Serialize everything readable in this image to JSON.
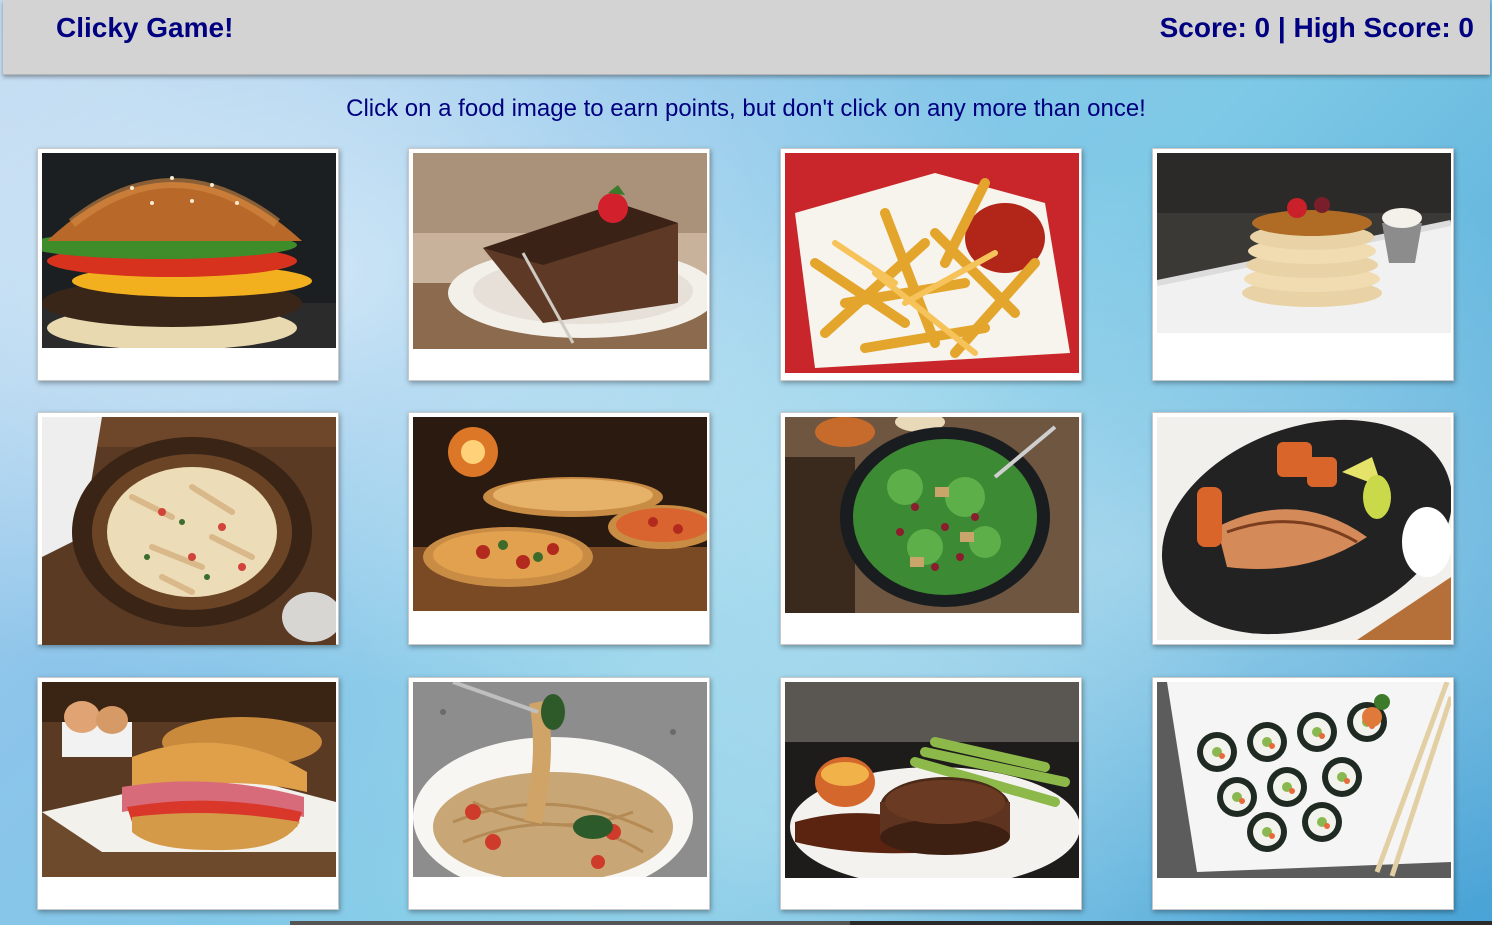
{
  "header": {
    "title": "Clicky Game!",
    "score_text": "Score: 0 | High Score: 0"
  },
  "game": {
    "score": 0,
    "high_score": 0,
    "instructions": "Click on a food image to earn points, but don't click on any more than once!"
  },
  "colors": {
    "navbar": "#d3d3d3",
    "text": "#000080",
    "card": "#ffffff"
  },
  "cards": [
    {
      "food": "burger"
    },
    {
      "food": "chocolate-cake"
    },
    {
      "food": "french-fries"
    },
    {
      "food": "pancakes"
    },
    {
      "food": "pasta"
    },
    {
      "food": "pizza"
    },
    {
      "food": "salad"
    },
    {
      "food": "salmon"
    },
    {
      "food": "sandwich"
    },
    {
      "food": "spaghetti"
    },
    {
      "food": "steak"
    },
    {
      "food": "sushi"
    }
  ]
}
